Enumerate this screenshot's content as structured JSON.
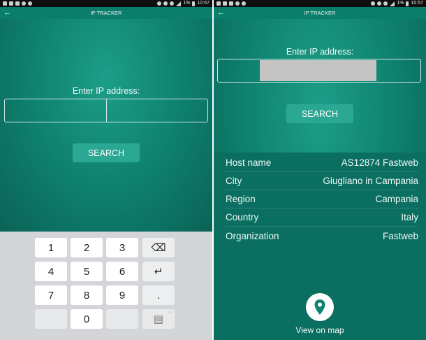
{
  "status": {
    "time": "10:57",
    "battery": "1%"
  },
  "app": {
    "title": "IP TRACKER",
    "back": "←"
  },
  "form": {
    "label": "Enter IP address:",
    "search_label": "SEARCH",
    "value": ""
  },
  "keyboard": {
    "keys": [
      "1",
      "2",
      "3",
      "4",
      "5",
      "6",
      "7",
      "8",
      "9",
      "0",
      "."
    ],
    "backspace": "⌫",
    "enter": "↵",
    "mini_label": "⋯",
    "clipboard": "▤"
  },
  "results": [
    {
      "label": "Host name",
      "value": "AS12874 Fastweb"
    },
    {
      "label": "City",
      "value": "Giugliano in Campania"
    },
    {
      "label": "Region",
      "value": "Campania"
    },
    {
      "label": "Country",
      "value": "Italy"
    },
    {
      "label": "Organization",
      "value": "Fastweb"
    }
  ],
  "map": {
    "label": "View on map",
    "icon": "map-pin-icon"
  },
  "colors": {
    "accent": "#0f8270",
    "button": "#2aa893",
    "appbar": "#0b7d6b",
    "keyboard": "#d3d5d8"
  }
}
